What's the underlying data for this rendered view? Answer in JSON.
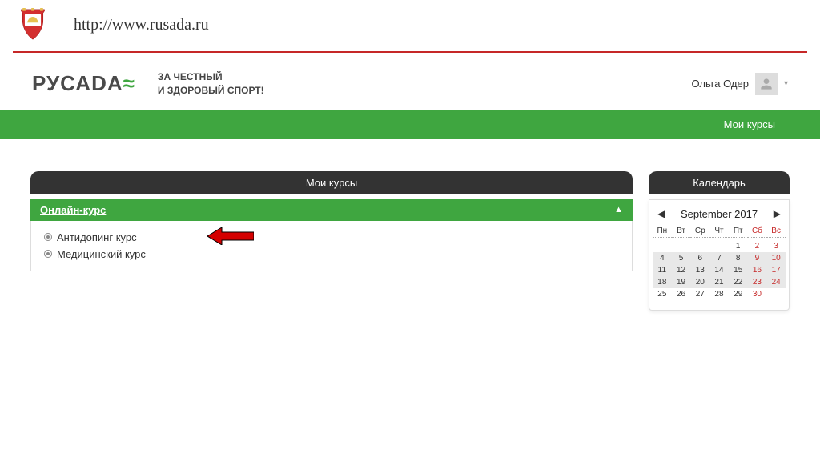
{
  "url": "http://www.rusada.ru",
  "logo_text": "РУСАD",
  "logo_suffix": "A",
  "slogan_line1": "ЗА ЧЕСТНЫЙ",
  "slogan_line2": "И ЗДОРОВЫЙ СПОРТ!",
  "user_name": "Ольга Одер",
  "nav_my_courses": "Мои курсы",
  "panel_courses_title": "Мои курсы",
  "section_title": "Онлайн-курс",
  "section_toggle": "▲",
  "courses": [
    {
      "label": "Антидопинг курс"
    },
    {
      "label": "Медицинский курс"
    }
  ],
  "calendar": {
    "title": "Календарь",
    "prev": "◀",
    "next": "▶",
    "month": "September 2017",
    "days": [
      "Пн",
      "Вт",
      "Ср",
      "Чт",
      "Пт",
      "Сб",
      "Вс"
    ],
    "weeks": [
      [
        "",
        "",
        "",
        "",
        "1",
        "2",
        "3"
      ],
      [
        "4",
        "5",
        "6",
        "7",
        "8",
        "9",
        "10"
      ],
      [
        "11",
        "12",
        "13",
        "14",
        "15",
        "16",
        "17"
      ],
      [
        "18",
        "19",
        "20",
        "21",
        "22",
        "23",
        "24"
      ],
      [
        "25",
        "26",
        "27",
        "28",
        "29",
        "30",
        ""
      ]
    ],
    "highlight_start_week": 1
  }
}
